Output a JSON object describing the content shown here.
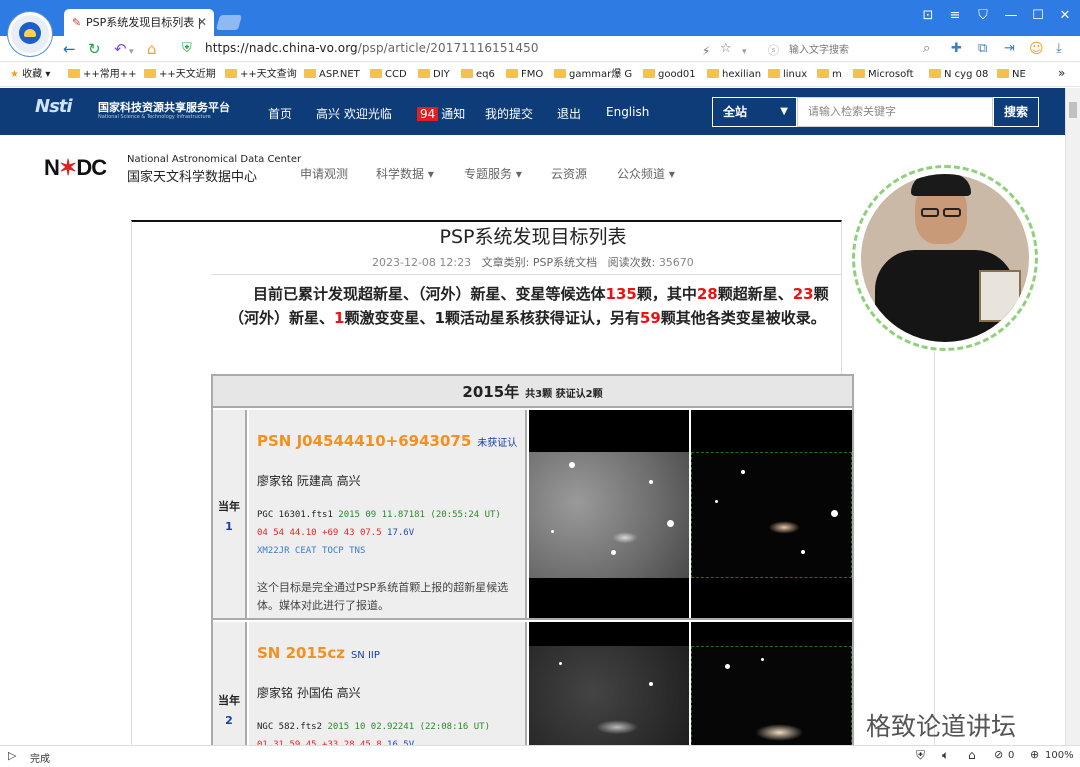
{
  "browser": {
    "tab_title": "PSP系统发现目标列表 |",
    "url_host": "https://nadc.china-vo.org",
    "url_path": "/psp/article/20171116151450",
    "search_placeholder": "输入文字搜索",
    "window_controls": [
      "minimize-icon",
      "maximize-icon",
      "close-icon"
    ],
    "accent": "#2e7be4"
  },
  "bookmarks": [
    {
      "label": "收藏"
    },
    {
      "label": "++常用++"
    },
    {
      "label": "++天文近期"
    },
    {
      "label": "++天文查询"
    },
    {
      "label": "ASP.NET"
    },
    {
      "label": "CCD"
    },
    {
      "label": "DIY"
    },
    {
      "label": "eq6"
    },
    {
      "label": "FMO"
    },
    {
      "label": "gammar爆 G"
    },
    {
      "label": "good01"
    },
    {
      "label": "hexilian"
    },
    {
      "label": "linux"
    },
    {
      "label": "m"
    },
    {
      "label": "Microsoft"
    },
    {
      "label": "N cyg 08"
    },
    {
      "label": "NE"
    }
  ],
  "site_header": {
    "logo_en": "Nsti",
    "logo_cn": "国家科技资源共享服务平台",
    "logo_sub": "National Science & Technology Infrastructure",
    "nav": {
      "home": "首页",
      "welcome": "高兴 欢迎光临",
      "notice_count": "94",
      "notice": "通知",
      "my_submit": "我的提交",
      "logout": "退出",
      "english": "English"
    },
    "search_scope": "全站",
    "search_placeholder": "请输入检索关键字",
    "search_button": "搜索",
    "brand_color": "#0d3c79"
  },
  "nadc": {
    "logo": "NADC",
    "name_en": "National Astronomical Data Center",
    "name_cn": "国家天文科学数据中心",
    "menu": [
      "申请观测",
      "科学数据",
      "专题服务",
      "云资源",
      "公众频道"
    ]
  },
  "article": {
    "title": "PSP系统发现目标列表",
    "date": "2023-12-08 12:23",
    "category_label": "文章类别:",
    "category": "PSP系统文档",
    "views_label": "阅读次数:",
    "views": "35670",
    "intro": {
      "p1": "目前已累计发现超新星、（河外）新星、变星等候选体",
      "n1": "135",
      "p2": "颗，其中",
      "n2": "28",
      "p3": "颗超新星、",
      "n3": "23",
      "p4": "颗（河外）新星、",
      "n4": "1",
      "p5": "颗激变变星、1颗活动星系核获得证认，另有",
      "n5": "59",
      "p6": "颗其他各类变星被收录。"
    }
  },
  "discoveries": {
    "year": "2015年",
    "summary": "共3颗 获证认2颗",
    "rows": [
      {
        "period": "当年",
        "num": "1",
        "name": "PSN J04544410+6943075",
        "status": "未获证认",
        "observers": "廖家铭 阮建高 高兴",
        "file": "PGC 16301.fts1",
        "date": "2015 09 11.87181",
        "time": "(20:55:24 UT)",
        "coords": "04 54 44.10 +69 43 07.5",
        "mag": "17.6V",
        "refs": "XM22JR CEAT TOCP TNS",
        "note": "这个目标是完全通过PSP系统首颗上报的超新星候选体。媒体对此进行了报道。"
      },
      {
        "period": "当年",
        "num": "2",
        "name": "SN 2015cz",
        "status": "SN IIP",
        "observers": "廖家铭 孙国佑 高兴",
        "file": "NGC 582.fts2",
        "date": "2015 10 02.92241",
        "time": "(22:08:16 UT)",
        "coords": "01 31 59.45 +33 28 45.8",
        "mag": "16.5V",
        "refs": "",
        "note": ""
      }
    ]
  },
  "watermark": "格致论道讲坛",
  "statusbar": {
    "status": "完成",
    "counter": "0",
    "zoom": "100%"
  }
}
